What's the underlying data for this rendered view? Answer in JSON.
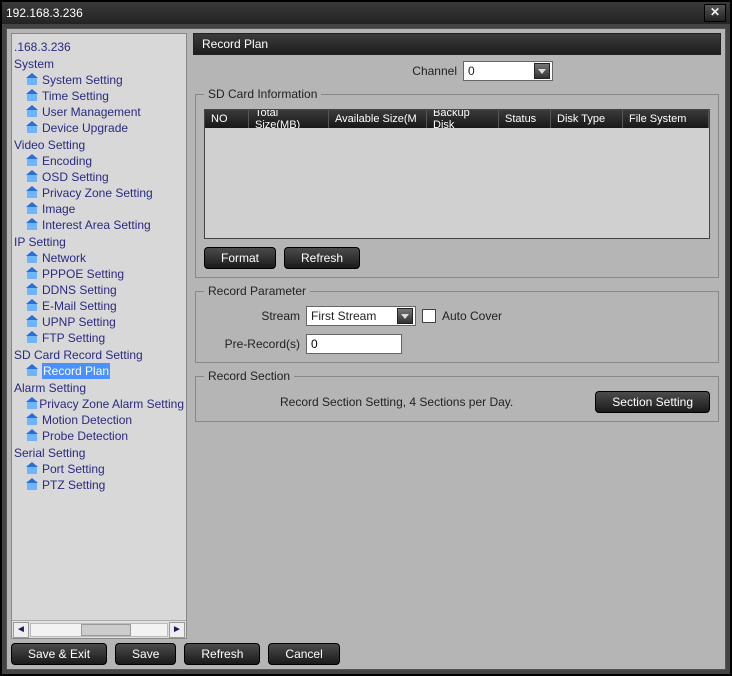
{
  "window": {
    "title": "192.168.3.236"
  },
  "sidebar": {
    "root": ".168.3.236",
    "groups": [
      {
        "label": "System",
        "items": [
          "System Setting",
          "Time Setting",
          "User Management",
          "Device Upgrade"
        ]
      },
      {
        "label": "Video Setting",
        "items": [
          "Encoding",
          "OSD Setting",
          "Privacy Zone Setting",
          "Image",
          "Interest Area Setting"
        ]
      },
      {
        "label": "IP Setting",
        "items": [
          "Network",
          "PPPOE Setting",
          "DDNS Setting",
          "E-Mail Setting",
          "UPNP Setting",
          "FTP Setting"
        ]
      },
      {
        "label": "SD Card Record Setting",
        "items": [
          "Record Plan"
        ],
        "selected": 0
      },
      {
        "label": "Alarm Setting",
        "items": [
          "Privacy Zone Alarm Setting",
          "Motion Detection",
          "Probe Detection"
        ]
      },
      {
        "label": "Serial Setting",
        "items": [
          "Port Setting",
          "PTZ Setting"
        ]
      }
    ]
  },
  "heading": "Record Plan",
  "channel": {
    "label": "Channel",
    "value": "0"
  },
  "sd": {
    "legend": "SD Card Information",
    "columns": {
      "no": "NO",
      "total": "Total Size(MB)",
      "avail": "Available Size(M",
      "backup": "Backup Disk",
      "status": "Status",
      "dtype": "Disk Type",
      "fs": "File System"
    },
    "format_btn": "Format",
    "refresh_btn": "Refresh"
  },
  "param": {
    "legend": "Record Parameter",
    "stream_label": "Stream",
    "stream_value": "First Stream",
    "autocover_label": "Auto Cover",
    "prerecord_label": "Pre-Record(s)",
    "prerecord_value": "0"
  },
  "section": {
    "legend": "Record Section",
    "text": "Record Section Setting, 4 Sections per Day.",
    "btn": "Section Setting"
  },
  "footer": {
    "save_exit": "Save & Exit",
    "save": "Save",
    "refresh": "Refresh",
    "cancel": "Cancel"
  }
}
